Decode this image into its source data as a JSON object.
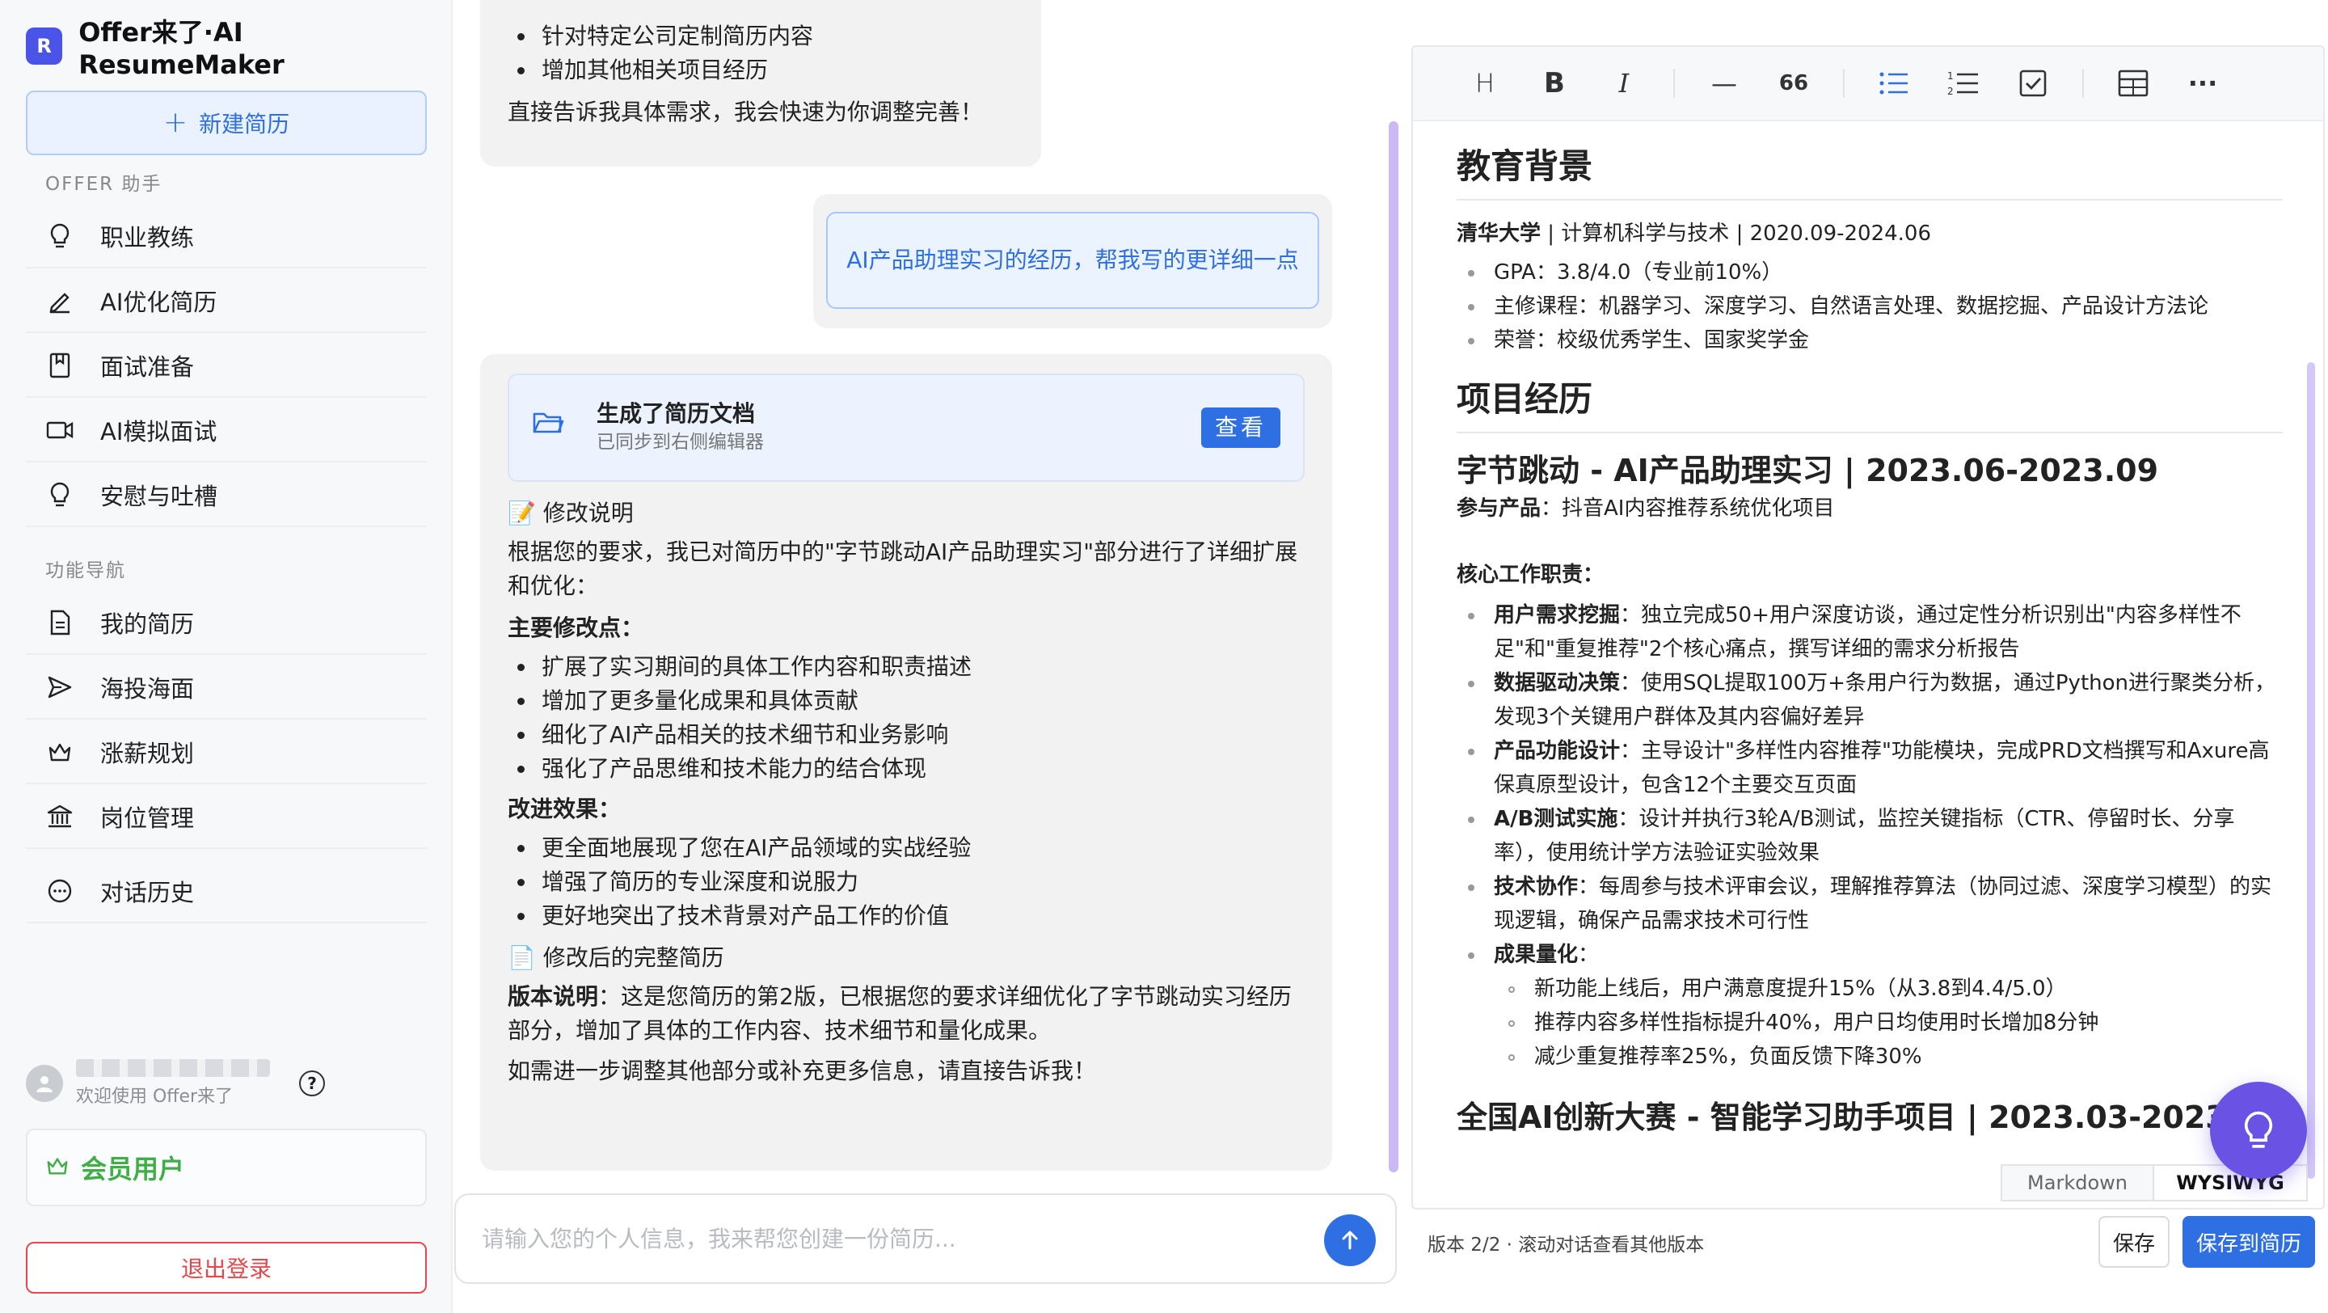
{
  "app": {
    "logo_letter": "R",
    "title": "Offer来了·AI ResumeMaker"
  },
  "sidebar": {
    "new_resume": "新建简历",
    "section_assistant": "OFFER 助手",
    "assistant_items": [
      {
        "label": "职业教练",
        "icon": "lightbulb-icon"
      },
      {
        "label": "AI优化简历",
        "icon": "pen-icon"
      },
      {
        "label": "面试准备",
        "icon": "bookmark-icon"
      },
      {
        "label": "AI模拟面试",
        "icon": "video-icon"
      },
      {
        "label": "安慰与吐槽",
        "icon": "lightbulb-icon"
      }
    ],
    "section_nav": "功能导航",
    "nav_items": [
      {
        "label": "我的简历",
        "icon": "document-icon"
      },
      {
        "label": "海投海面",
        "icon": "send-icon"
      },
      {
        "label": "涨薪规划",
        "icon": "crown-icon"
      },
      {
        "label": "岗位管理",
        "icon": "bank-icon"
      },
      {
        "label": "对话历史",
        "icon": "chat-icon"
      }
    ],
    "user": {
      "welcome": "欢迎使用 Offer来了"
    },
    "member_label": "会员用户",
    "logout": "退出登录"
  },
  "chat": {
    "msg1": {
      "bullets": [
        "针对特定公司定制简历内容",
        "增加其他相关项目经历"
      ],
      "closing": "直接告诉我具体需求，我会快速为你调整完善！"
    },
    "user_msg": "AI产品助理实习的经历，帮我写的更详细一点",
    "msg2": {
      "doc_card": {
        "title": "生成了简历文档",
        "subtitle": "已同步到右侧编辑器",
        "view": "查看"
      },
      "section1": "📝 修改说明",
      "intro": "根据您的要求，我已对简历中的\"字节跳动AI产品助理实习\"部分进行了详细扩展和优化：",
      "main_points_title": "主要修改点：",
      "main_points": [
        "扩展了实习期间的具体工作内容和职责描述",
        "增加了更多量化成果和具体贡献",
        "细化了AI产品相关的技术细节和业务影响",
        "强化了产品思维和技术能力的结合体现"
      ],
      "effects_title": "改进效果：",
      "effects": [
        "更全面地展现了您在AI产品领域的实战经验",
        "增强了简历的专业深度和说服力",
        "更好地突出了技术背景对产品工作的价值"
      ],
      "section2": "📄 修改后的完整简历",
      "version_label": "版本说明",
      "version_text": "：这是您简历的第2版，已根据您的要求详细优化了字节跳动实习经历部分，增加了具体的工作内容、技术细节和量化成果。",
      "closing": "如需进一步调整其他部分或补充更多信息，请直接告诉我！"
    },
    "input_placeholder": "请输入您的个人信息，我来帮您创建一份简历..."
  },
  "editor": {
    "toolbar": [
      {
        "name": "heading-icon",
        "glyph": "H"
      },
      {
        "name": "bold-icon",
        "glyph": "B"
      },
      {
        "name": "italic-icon",
        "glyph": "I"
      },
      {
        "name": "horizontal-rule-icon",
        "glyph": "—"
      },
      {
        "name": "quote-icon",
        "glyph": "66"
      },
      {
        "name": "bullet-list-icon",
        "glyph": ""
      },
      {
        "name": "ordered-list-icon",
        "glyph": ""
      },
      {
        "name": "task-list-icon",
        "glyph": ""
      },
      {
        "name": "table-icon",
        "glyph": ""
      },
      {
        "name": "more-icon",
        "glyph": "···"
      }
    ],
    "edu_title": "教育背景",
    "edu_school": "清华大学",
    "edu_line": " | 计算机科学与技术 | 2020.09-2024.06",
    "edu_items": [
      "GPA：3.8/4.0（专业前10%）",
      "主修课程：机器学习、深度学习、自然语言处理、数据挖掘、产品设计方法论",
      "荣誉：校级优秀学生、国家奖学金"
    ],
    "proj_title": "项目经历",
    "job_title": "字节跳动 - AI产品助理实习 | 2023.06-2023.09",
    "product_label": "参与产品",
    "product_value": "：抖音AI内容推荐系统优化项目",
    "duties_label": "核心工作职责",
    "duties": [
      {
        "b": "用户需求挖掘",
        "t": "：独立完成50+用户深度访谈，通过定性分析识别出\"内容多样性不足\"和\"重复推荐\"2个核心痛点，撰写详细的需求分析报告"
      },
      {
        "b": "数据驱动决策",
        "t": "：使用SQL提取100万+条用户行为数据，通过Python进行聚类分析，发现3个关键用户群体及其内容偏好差异"
      },
      {
        "b": "产品功能设计",
        "t": "：主导设计\"多样性内容推荐\"功能模块，完成PRD文档撰写和Axure高保真原型设计，包含12个主要交互页面"
      },
      {
        "b": "A/B测试实施",
        "t": "：设计并执行3轮A/B测试，监控关键指标（CTR、停留时长、分享率），使用统计学方法验证实验效果"
      },
      {
        "b": "技术协作",
        "t": "：每周参与技术评审会议，理解推荐算法（协同过滤、深度学习模型）的实现逻辑，确保产品需求技术可行性"
      },
      {
        "b": "成果量化",
        "t": "："
      }
    ],
    "results": [
      "新功能上线后，用户满意度提升15%（从3.8到4.4/5.0）",
      "推荐内容多样性指标提升40%，用户日均使用时长增加8分钟",
      "减少重复推荐率25%，负面反馈下降30%"
    ],
    "next_title": "全国AI创新大赛 - 智能学习助手项目 | 2023.03-2023.",
    "mode_markdown": "Markdown",
    "mode_wysiwyg": "WYSIWYG"
  },
  "footer": {
    "status": "版本 2/2 · 滚动对话查看其他版本",
    "save": "保存",
    "save_to_resume": "保存到简历"
  }
}
